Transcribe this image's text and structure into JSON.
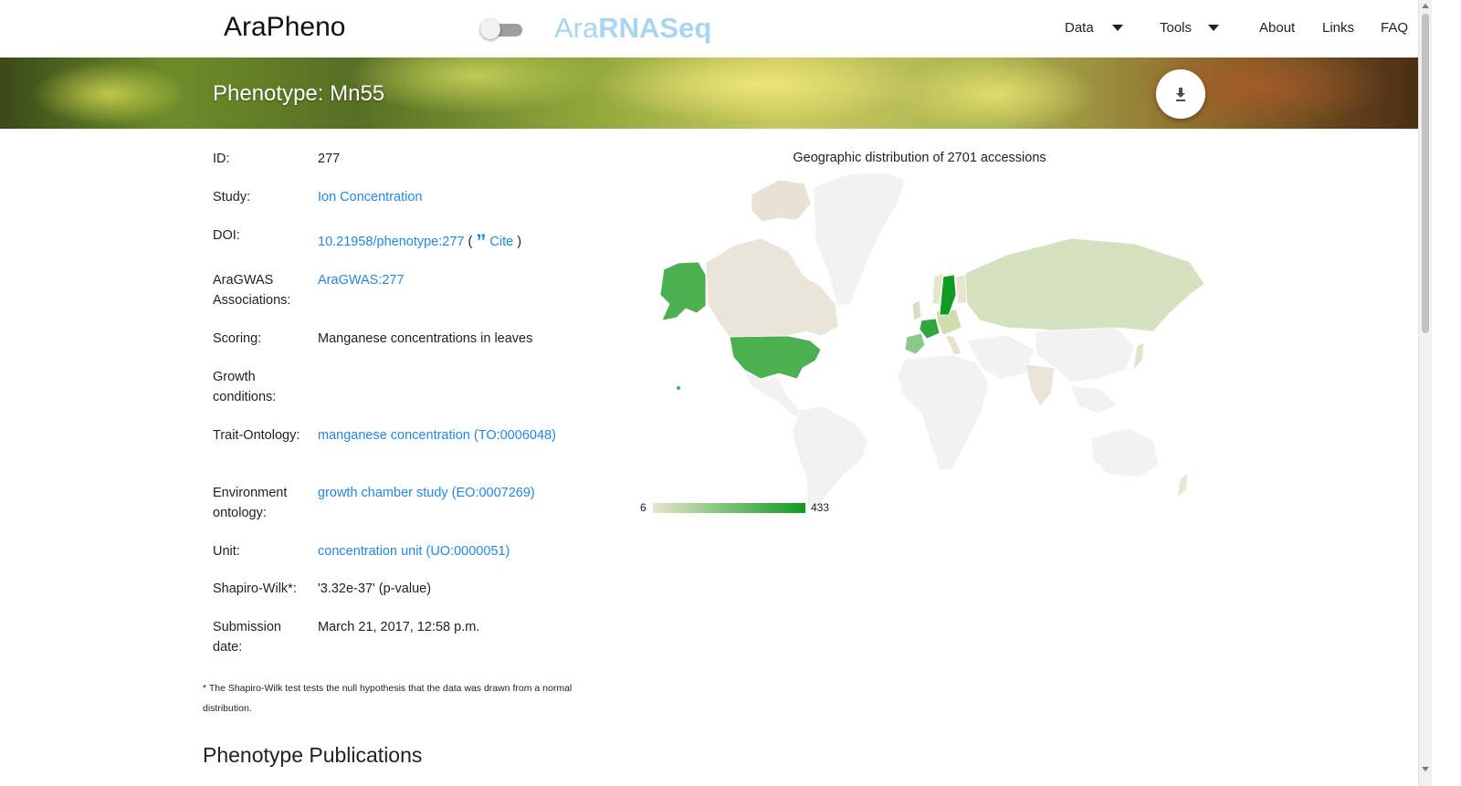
{
  "nav": {
    "brand": "AraPheno",
    "brand2_light": "Ara",
    "brand2_bold": "RNASeq",
    "items": [
      {
        "label": "Data",
        "dropdown": true
      },
      {
        "label": "Tools",
        "dropdown": true
      },
      {
        "label": "About",
        "dropdown": false
      },
      {
        "label": "Links",
        "dropdown": false
      },
      {
        "label": "FAQ",
        "dropdown": false
      }
    ],
    "toggle_on": false
  },
  "banner": {
    "title": "Phenotype: Mn55",
    "download_icon": "download-icon"
  },
  "details": {
    "id": {
      "label": "ID:",
      "value": "277"
    },
    "study": {
      "label": "Study:",
      "value": "Ion Concentration"
    },
    "doi": {
      "label": "DOI:",
      "value": "10.21958/phenotype:277",
      "open": "(",
      "cite_icon": "quote-icon",
      "cite": "Cite",
      "close": ")"
    },
    "aragwas": {
      "label": "AraGWAS Associations:",
      "value": "AraGWAS:277"
    },
    "scoring": {
      "label": "Scoring:",
      "value": "Manganese concentrations in leaves"
    },
    "growth": {
      "label": "Growth conditions:",
      "value": ""
    },
    "trait": {
      "label": "Trait-Ontology:",
      "value": "manganese concentration (TO:0006048)"
    },
    "environment": {
      "label": "Environment ontology:",
      "value": "growth chamber study (EO:0007269)"
    },
    "unit": {
      "label": "Unit:",
      "value": "concentration unit (UO:0000051)"
    },
    "shapiro": {
      "label": "Shapiro-Wilk*:",
      "value": "'3.32e-37' (p-value)"
    },
    "submission": {
      "label": "Submission date:",
      "value": "March 21, 2017, 12:58 p.m."
    }
  },
  "footnote": "* The Shapiro-Wilk test tests the null hypothesis that the data was drawn from a normal distribution.",
  "publications_heading": "Phenotype Publications",
  "map": {
    "title": "Geographic distribution of 2701 accessions",
    "legend_min": "6",
    "legend_max": "433",
    "colors": {
      "low": "#e5e6cc",
      "high": "#0f9a21",
      "no_data": "#f2f2f2",
      "border": "#ffffff"
    }
  }
}
